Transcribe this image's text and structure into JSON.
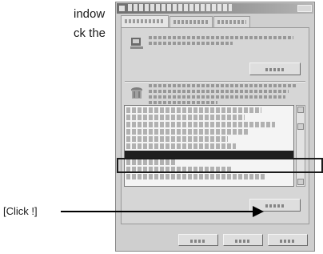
{
  "manual": {
    "line1": "indow",
    "line2": "ck the"
  },
  "callout": {
    "label": "[Click !]"
  },
  "dialog": {
    "tabs": [
      "",
      "",
      ""
    ],
    "list_row_count": 8
  }
}
